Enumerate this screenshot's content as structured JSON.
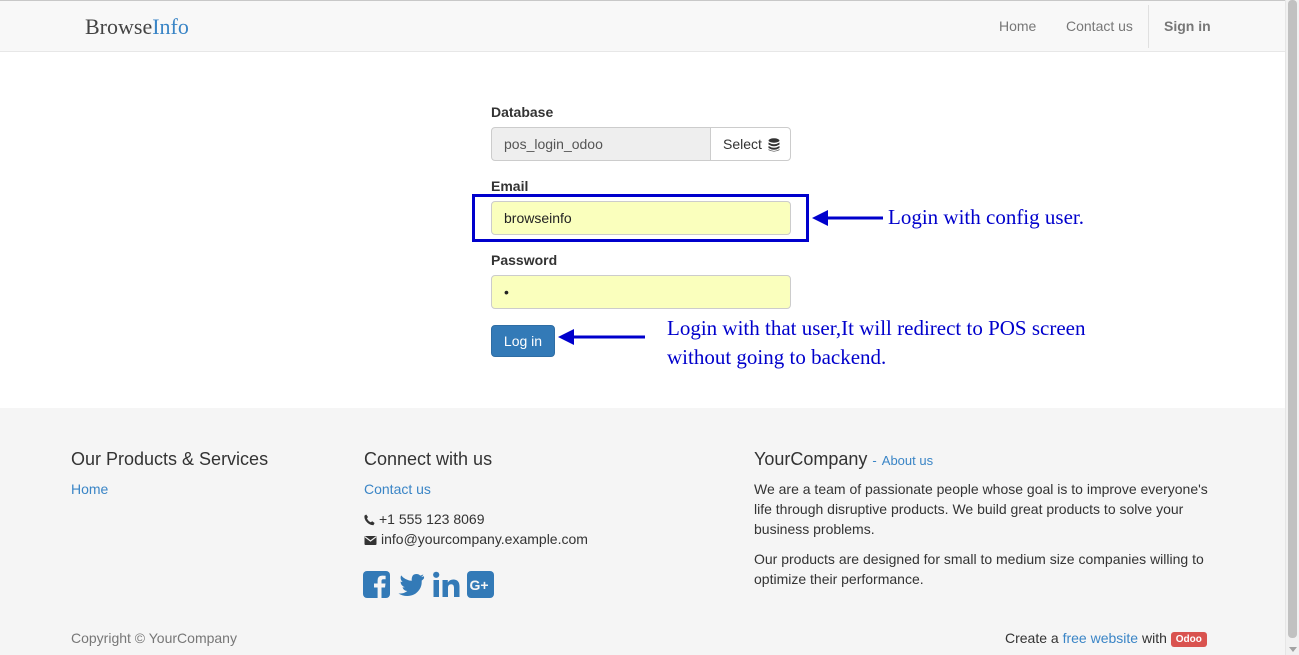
{
  "navbar": {
    "brand_part1": "Browse",
    "brand_part2": "Info",
    "links": [
      "Home",
      "Contact us"
    ],
    "signin": "Sign in"
  },
  "form": {
    "database_label": "Database",
    "database_value": "pos_login_odoo",
    "select_label": "Select",
    "email_label": "Email",
    "email_value": "browseinfo",
    "password_label": "Password",
    "password_value": "•",
    "login_button": "Log in"
  },
  "annotations": {
    "email_note": "Login with config user.",
    "login_note_line1": "Login with that user,It will redirect to POS screen",
    "login_note_line2": "without going to backend.",
    "color": "#0000cc"
  },
  "footer": {
    "products_heading": "Our Products & Services",
    "products_link": "Home",
    "connect_heading": "Connect with us",
    "contact_link": "Contact us",
    "phone": "+1 555 123 8069",
    "email": "info@yourcompany.example.com",
    "social_icons": [
      "facebook-icon",
      "twitter-icon",
      "linkedin-icon",
      "google-plus-icon"
    ],
    "company_heading": "YourCompany",
    "about_link": "About us",
    "about_para1": "We are a team of passionate people whose goal is to improve everyone's life through disruptive products. We build great products to solve your business problems.",
    "about_para2": "Our products are designed for small to medium size companies willing to optimize their performance.",
    "copyright": "Copyright © YourCompany",
    "create_prefix": "Create a",
    "create_link": "free website",
    "create_with": "with",
    "odoo_badge": "Odoo"
  },
  "colors": {
    "link_blue": "#3a85c6",
    "primary_button": "#337ab7",
    "autofill_yellow": "#faffbd",
    "odoo_red": "#d9534f"
  }
}
